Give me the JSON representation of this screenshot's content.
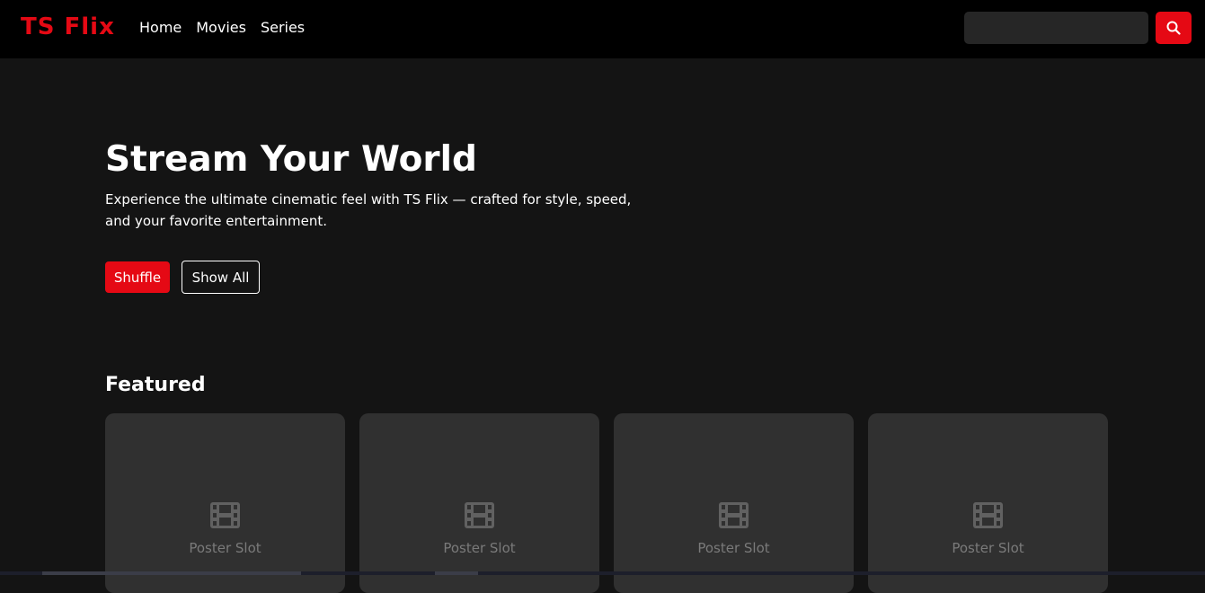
{
  "brand": {
    "logo": "TS Flix",
    "accent_color": "#e50914"
  },
  "nav": {
    "items": [
      "Home",
      "Movies",
      "Series"
    ]
  },
  "search": {
    "placeholder": "",
    "button_icon": "search-icon"
  },
  "hero": {
    "title": "Stream Your World",
    "description": "Experience the ultimate cinematic feel with TS Flix — crafted for style, speed, and your favorite entertainment.",
    "shuffle_label": "Shuffle",
    "show_all_label": "Show All"
  },
  "featured": {
    "title": "Featured",
    "cards": [
      {
        "icon": "film-icon",
        "caption": "Poster Slot"
      },
      {
        "icon": "film-icon",
        "caption": "Poster Slot"
      },
      {
        "icon": "film-icon",
        "caption": "Poster Slot"
      },
      {
        "icon": "film-icon",
        "caption": "Poster Slot"
      }
    ]
  }
}
